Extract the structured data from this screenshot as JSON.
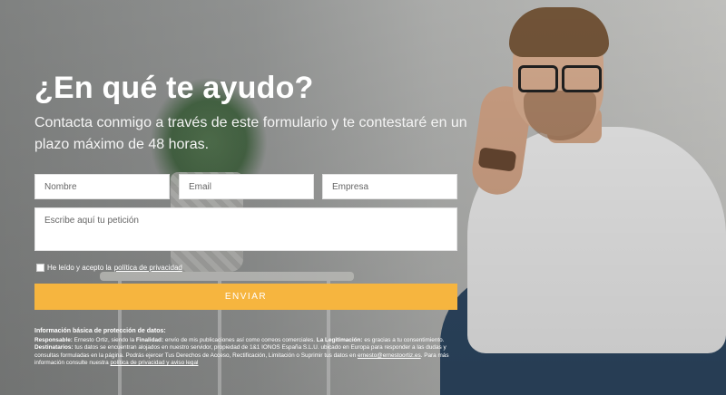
{
  "hero": {
    "title": "¿En qué te ayudo?",
    "subtitle": "Contacta conmigo a través de este formulario y te contestaré en un plazo máximo de 48 horas."
  },
  "form": {
    "nombre_placeholder": "Nombre",
    "email_placeholder": "Email",
    "empresa_placeholder": "Empresa",
    "peticion_placeholder": "Escribe aquí tu petición",
    "consent_prefix": "He leído y acepto la ",
    "consent_link": "política de privacidad",
    "submit_label": "ENVIAR",
    "submit_color": "#f6b53f"
  },
  "legal": {
    "heading": "Información básica de protección de datos:",
    "responsable_label": "Responsable:",
    "responsable_text": " Ernesto Ortiz, siendo la ",
    "finalidad_label": "Finalidad:",
    "finalidad_text": " envío de mis publicaciones así como correos comerciales. ",
    "legitimacion_label": "La Legitimación:",
    "legitimacion_text": " es gracias a tu consentimiento.",
    "destinatarios_label": "Destinatarios:",
    "destinatarios_text": " tus datos se encuentran alojados en nuestro servidor, propiedad de 1&1 IONOS España S.L.U. ubicado en Europa para responder a las dudas y consultas formuladas en la página. Podrás ejercer Tus Derechos de Acceso, Rectificación, Limitación o Suprimir tus datos en ",
    "email_link": "ernesto@ernestoortiz.es",
    "more_text": ". Para más información consulte nuestra ",
    "policy_link": "política de privacidad y aviso legal"
  }
}
